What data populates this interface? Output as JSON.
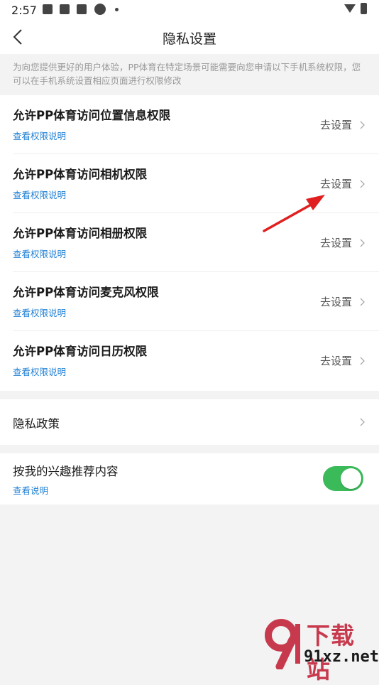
{
  "status_bar": {
    "time": "2:57"
  },
  "nav": {
    "title": "隐私设置"
  },
  "notice": {
    "text": "为向您提供更好的用户体验，PP体育在特定场景可能需要向您申请以下手机系统权限，您可以在手机系统设置相应页面进行权限修改"
  },
  "permissions": [
    {
      "title": "允许PP体育访问位置信息权限",
      "link": "查看权限说明",
      "action": "去设置"
    },
    {
      "title": "允许PP体育访问相机权限",
      "link": "查看权限说明",
      "action": "去设置"
    },
    {
      "title": "允许PP体育访问相册权限",
      "link": "查看权限说明",
      "action": "去设置"
    },
    {
      "title": "允许PP体育访问麦克风权限",
      "link": "查看权限说明",
      "action": "去设置"
    },
    {
      "title": "允许PP体育访问日历权限",
      "link": "查看权限说明",
      "action": "去设置"
    }
  ],
  "privacy_policy": {
    "label": "隐私政策"
  },
  "recommend": {
    "title": "按我的兴趣推荐内容",
    "link": "查看说明",
    "enabled": true
  },
  "watermark": {
    "top": "下载站",
    "bottom": "91xz.net"
  },
  "colors": {
    "link": "#1e7fd4",
    "toggle_on": "#3bba5a",
    "annotation_arrow": "#e02020",
    "watermark_red": "#c73a4d"
  },
  "icons": [
    "back-arrow-icon",
    "chevron-right-icon",
    "wifi-icon",
    "battery-icon"
  ]
}
